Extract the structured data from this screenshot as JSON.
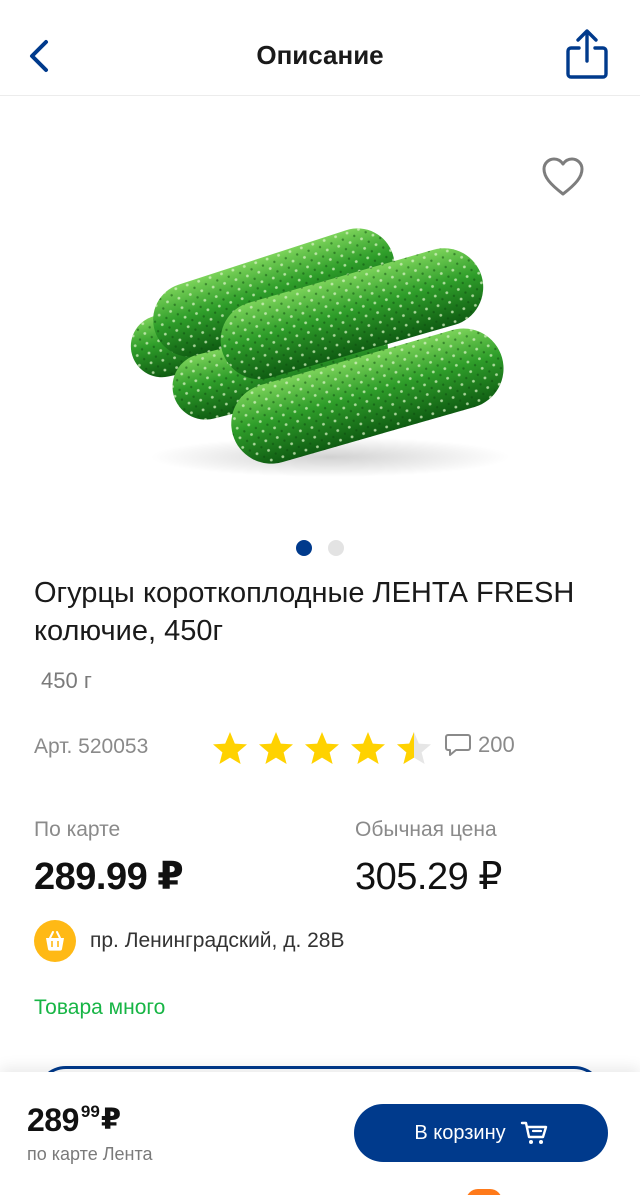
{
  "header": {
    "title": "Описание"
  },
  "product": {
    "title": "Огурцы короткоплодные ЛЕНТА FRESH колючие, 450г",
    "weight": "450 г",
    "article": "Арт. 520053",
    "rating": 4.5,
    "rating_max": 5,
    "reviews_count": "200",
    "gallery": {
      "image_count": 2,
      "active_index": 0
    }
  },
  "prices": {
    "card_label": "По карте",
    "card_price": "289.99 ₽",
    "regular_label": "Обычная цена",
    "regular_price": "305.29 ₽"
  },
  "store": {
    "address": "пр. Ленинградский, д. 28В"
  },
  "stock": {
    "status": "Товара много"
  },
  "bottom_bar": {
    "price_int": "289",
    "price_cents": "99",
    "currency": "₽",
    "caption": "по карте Лента",
    "cart_button_label": "В корзину"
  },
  "icons": {
    "back": "chevron-left-icon",
    "share": "share-icon",
    "favorite": "heart-icon",
    "star": "star-icon",
    "reviews": "comment-icon",
    "store": "basket-icon",
    "cart": "cart-icon"
  },
  "colors": {
    "brand_blue": "#003a8c",
    "star_yellow": "#ffd200",
    "stock_green": "#17b545",
    "store_badge": "#ffb915"
  }
}
